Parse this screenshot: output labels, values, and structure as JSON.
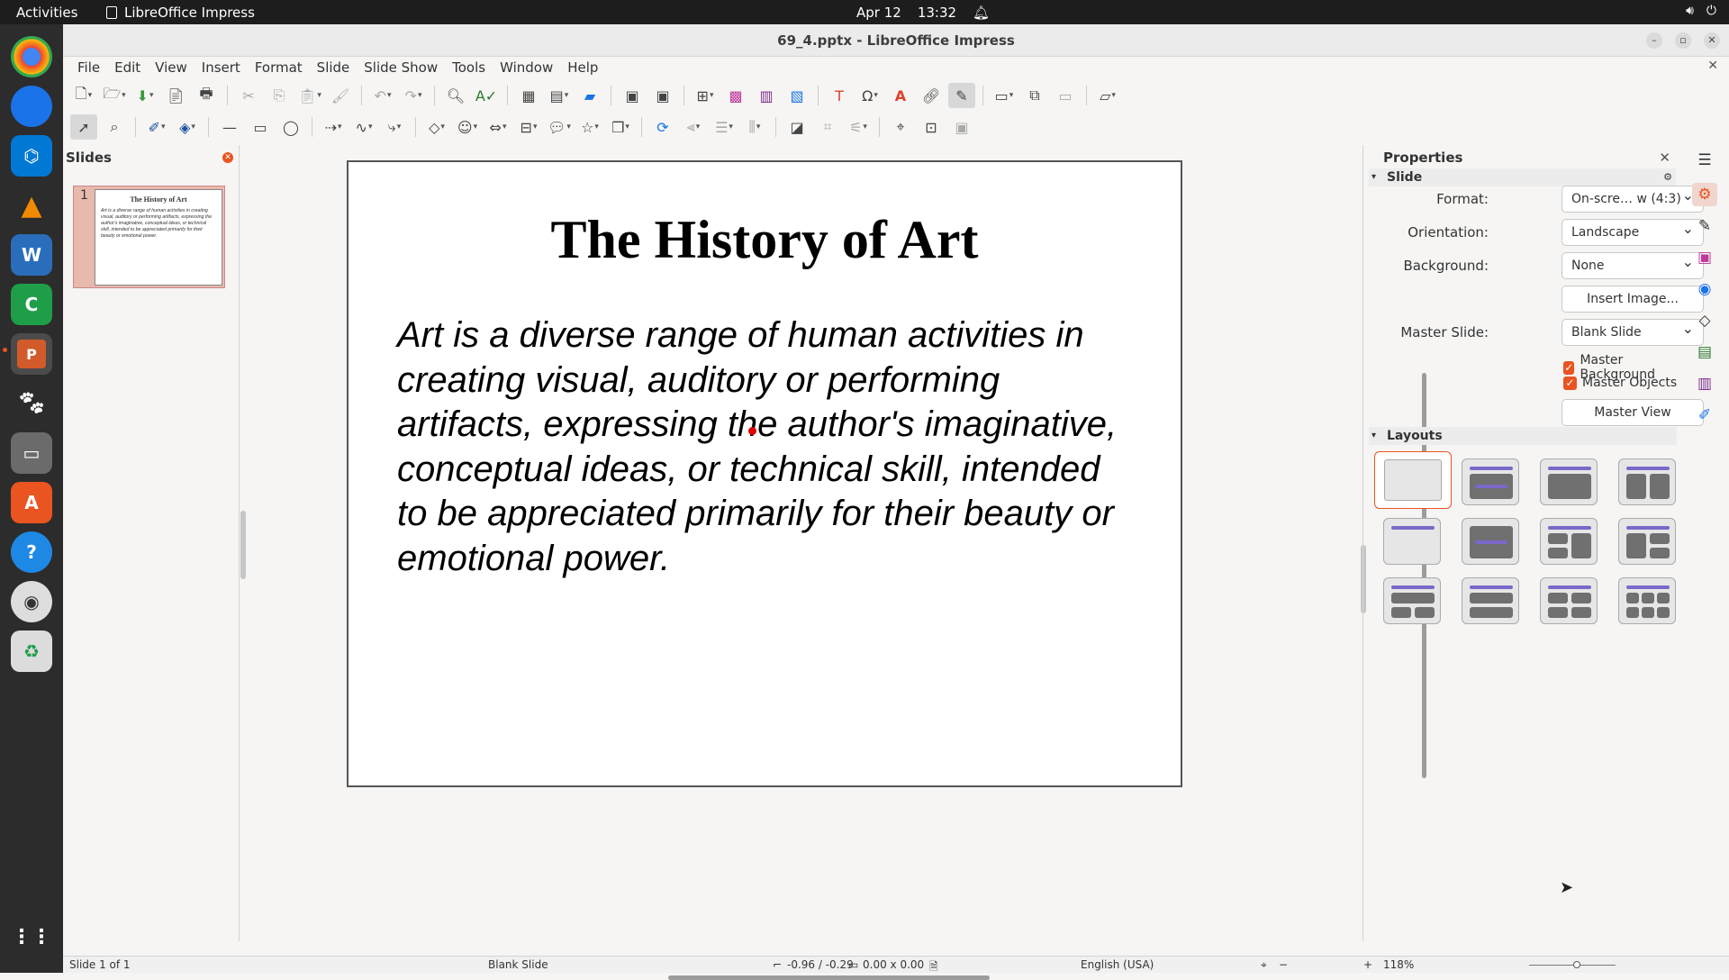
{
  "topbar": {
    "activities": "Activities",
    "app_name": "LibreOffice Impress",
    "date": "Apr 12",
    "time": "13:32"
  },
  "window": {
    "title": "69_4.pptx - LibreOffice Impress"
  },
  "menu": [
    "File",
    "Edit",
    "View",
    "Insert",
    "Format",
    "Slide",
    "Slide Show",
    "Tools",
    "Window",
    "Help"
  ],
  "slides_pane": {
    "title": "Slides",
    "thumb_number": "1",
    "thumb_title": "The History of Art",
    "thumb_body": "Art is a diverse range of human activities in creating visual, auditory or performing artifacts, expressing the author's imaginative, conceptual ideas, or technical skill, intended to be appreciated primarily for their beauty or emotional power."
  },
  "slide": {
    "title": "The History of Art",
    "body": "Art is a diverse range of human activities in creating visual, auditory or performing artifacts, expressing the author's imaginative, conceptual ideas, or technical skill, intended to be appreciated primarily for their beauty or emotional power."
  },
  "properties": {
    "title": "Properties",
    "section_slide": "Slide",
    "format_label": "Format:",
    "format_value": "On-scre… w (4:3)",
    "orientation_label": "Orientation:",
    "orientation_value": "Landscape",
    "background_label": "Background:",
    "background_value": "None",
    "insert_image": "Insert Image...",
    "master_slide_label": "Master Slide:",
    "master_slide_value": "Blank Slide",
    "master_background": "Master Background",
    "master_objects": "Master Objects",
    "master_view": "Master View",
    "section_layouts": "Layouts"
  },
  "status": {
    "slide_count": "Slide 1 of 1",
    "master": "Blank Slide",
    "position": "-0.96 / -0.29",
    "size": "0.00 x 0.00",
    "language": "English (USA)",
    "zoom": "118%"
  },
  "colors": {
    "accent": "#e95420",
    "layout_bar": "#7b68c9"
  }
}
